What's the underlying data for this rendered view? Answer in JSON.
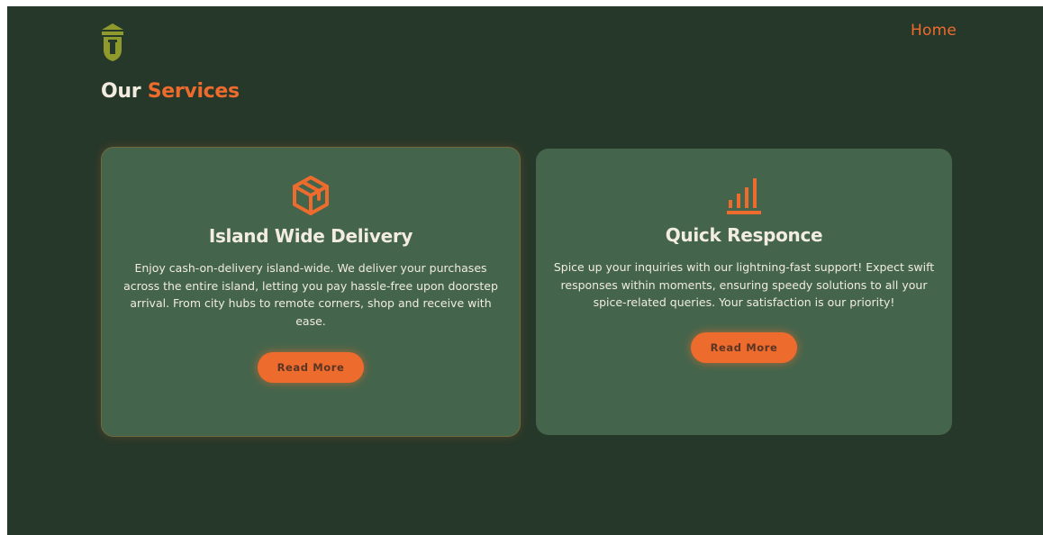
{
  "header": {
    "nav": {
      "home_label": "Home"
    }
  },
  "section": {
    "title_part1": "Our",
    "title_part2": "Services"
  },
  "cards": [
    {
      "icon": "package-box-icon",
      "title": "Island Wide Delivery",
      "description": "Enjoy cash-on-delivery island-wide. We deliver your purchases across the entire island, letting you pay hassle-free upon doorstep arrival. From city hubs to remote corners, shop and receive with ease.",
      "button_label": "Read More"
    },
    {
      "icon": "bar-chart-icon",
      "title": "Quick Responce",
      "description": "Spice up your inquiries with our lightning-fast support! Expect swift responses within moments, ensuring speedy solutions to all your spice-related queries. Your satisfaction is our priority!",
      "button_label": "Read More"
    }
  ],
  "colors": {
    "background": "#26382a",
    "card": "#44654c",
    "accent": "#ec6b2d",
    "logo": "#8e9a2c",
    "text_light": "#f1ebe0"
  }
}
